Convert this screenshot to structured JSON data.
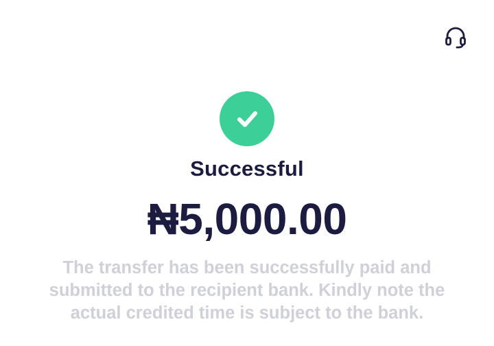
{
  "header": {
    "support_icon": "headset-icon"
  },
  "status": {
    "icon": "check-icon",
    "icon_color": "#3ccf98",
    "title": "Successful"
  },
  "transfer": {
    "amount": "₦5,000.00"
  },
  "message": {
    "text": "The transfer has been successfully paid and submitted to the recipient bank. Kindly note the actual credited time is subject to the bank."
  },
  "colors": {
    "text_primary": "#1b1c3f",
    "text_muted": "#cfd0d8",
    "success": "#3ccf98"
  }
}
